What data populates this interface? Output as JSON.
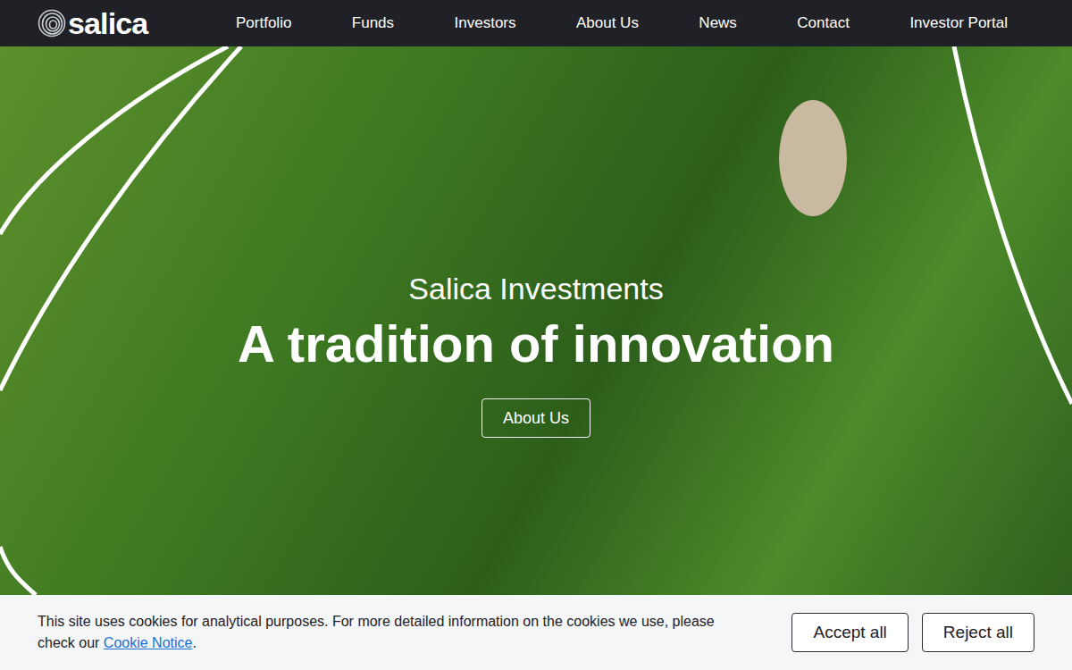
{
  "nav": {
    "logo": "salica",
    "items": [
      "Portfolio",
      "Funds",
      "Investors",
      "About Us",
      "News",
      "Contact",
      "Investor Portal"
    ]
  },
  "hero": {
    "eyebrow": "Salica Investments",
    "title": "A tradition of innovation",
    "button": "About Us"
  },
  "cookie_banner": {
    "text": "This site uses cookies for analytical purposes. For more detailed information on the cookies we use, please check our",
    "link": "Cookie Notice",
    "after_link": ".",
    "buttons": [
      "Accept all",
      "Reject all"
    ]
  }
}
